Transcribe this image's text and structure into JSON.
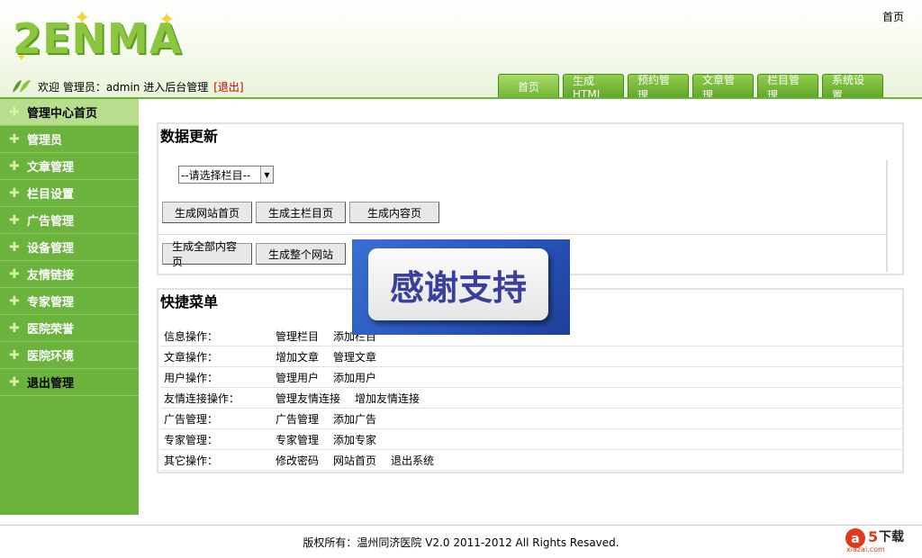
{
  "header": {
    "logo_text": "2ENMA",
    "top_home_link": "首页",
    "welcome_text": "欢迎 管理员：admin 进入后台管理",
    "logout_link": "[退出]"
  },
  "nav": {
    "tabs": [
      "首页",
      "生成HTML",
      "预约管理",
      "文章管理",
      "栏目管理",
      "系统设置"
    ]
  },
  "sidebar": {
    "items": [
      "管理中心首页",
      "管理员",
      "文章管理",
      "栏目设置",
      "广告管理",
      "设备管理",
      "友情链接",
      "专家管理",
      "医院荣誉",
      "医院环境",
      "退出管理"
    ]
  },
  "data_update": {
    "title": "数据更新",
    "select_value": "--请选择栏目--",
    "buttons_row1": [
      "生成网站首页",
      "生成主栏目页",
      "生成内容页"
    ],
    "buttons_row2": [
      "生成全部内容页",
      "生成整个网站"
    ]
  },
  "quick_menu": {
    "title": "快捷菜单",
    "rows": [
      {
        "label": "信息操作：",
        "links": [
          "管理栏目",
          "添加栏目"
        ]
      },
      {
        "label": "文章操作：",
        "links": [
          "增加文章",
          "管理文章"
        ]
      },
      {
        "label": "用户操作：",
        "links": [
          "管理用户",
          "添加用户"
        ]
      },
      {
        "label": "友情连接操作：",
        "links": [
          "管理友情连接",
          "增加友情连接"
        ]
      },
      {
        "label": "广告管理：",
        "links": [
          "广告管理",
          "添加广告"
        ]
      },
      {
        "label": "专家管理：",
        "links": [
          "专家管理",
          "添加专家"
        ]
      },
      {
        "label": "其它操作：",
        "links": [
          "修改密码",
          "网站首页",
          "退出系统"
        ]
      }
    ]
  },
  "overlay": {
    "banner_text": "感谢支持"
  },
  "footer": {
    "copyright": "版权所有：温州同济医院  V2.0 2011-2012 All Rights Resaved.",
    "watermark_text": "a5下载",
    "watermark_sub": "xiazai.com"
  },
  "colors": {
    "brand_green": "#6cb33e",
    "logout_red": "#cc0000"
  }
}
